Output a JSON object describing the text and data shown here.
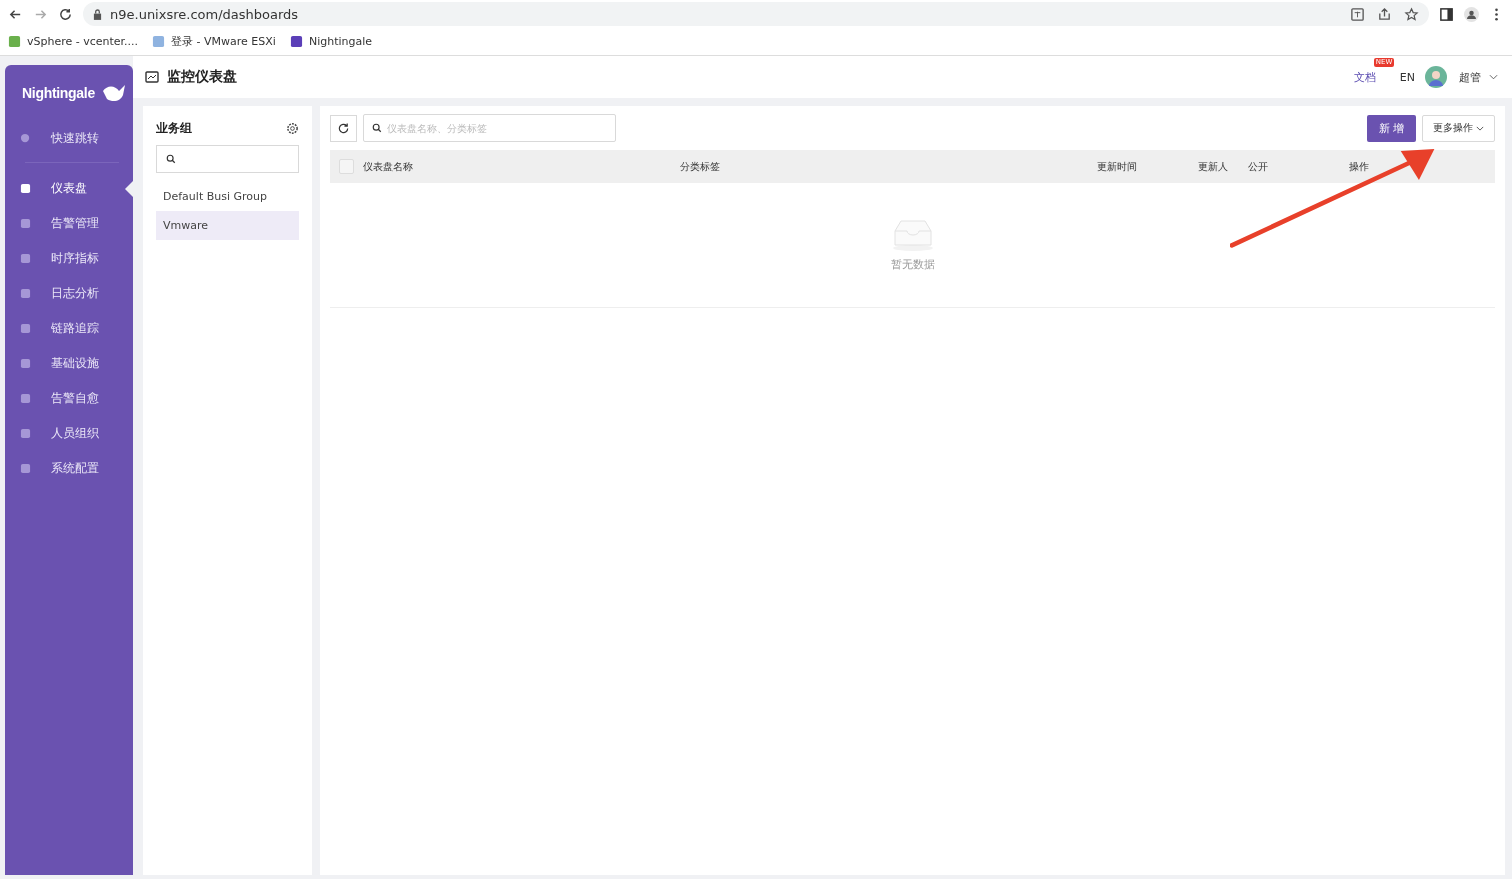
{
  "browser": {
    "url": "n9e.unixsre.com/dashboards",
    "bookmarks": [
      {
        "label": "vSphere - vcenter...."
      },
      {
        "label": "登录 - VMware ESXi"
      },
      {
        "label": "Nightingale"
      }
    ]
  },
  "sidebar": {
    "logo": "Nightingale",
    "quick": {
      "label": "快速跳转"
    },
    "items": [
      {
        "label": "仪表盘",
        "selected": true
      },
      {
        "label": "告警管理",
        "selected": false
      },
      {
        "label": "时序指标",
        "selected": false
      },
      {
        "label": "日志分析",
        "selected": false
      },
      {
        "label": "链路追踪",
        "selected": false
      },
      {
        "label": "基础设施",
        "selected": false
      },
      {
        "label": "告警自愈",
        "selected": false
      },
      {
        "label": "人员组织",
        "selected": false
      },
      {
        "label": "系统配置",
        "selected": false
      }
    ]
  },
  "header": {
    "title": "监控仪表盘",
    "docs": "文档",
    "docs_badge": "NEW",
    "language": "EN",
    "user": "超管"
  },
  "groups": {
    "title": "业务组",
    "items": [
      {
        "label": "Default Busi Group",
        "selected": false
      },
      {
        "label": "Vmware",
        "selected": true
      }
    ]
  },
  "toolbar": {
    "search_placeholder": "仪表盘名称、分类标签",
    "add_button": "新 增",
    "more_button": "更多操作"
  },
  "table": {
    "select_all": {
      "checked": false
    },
    "columns": [
      "仪表盘名称",
      "分类标签",
      "更新时间",
      "更新人",
      "公开",
      "操作"
    ],
    "empty_text": "暂无数据"
  }
}
